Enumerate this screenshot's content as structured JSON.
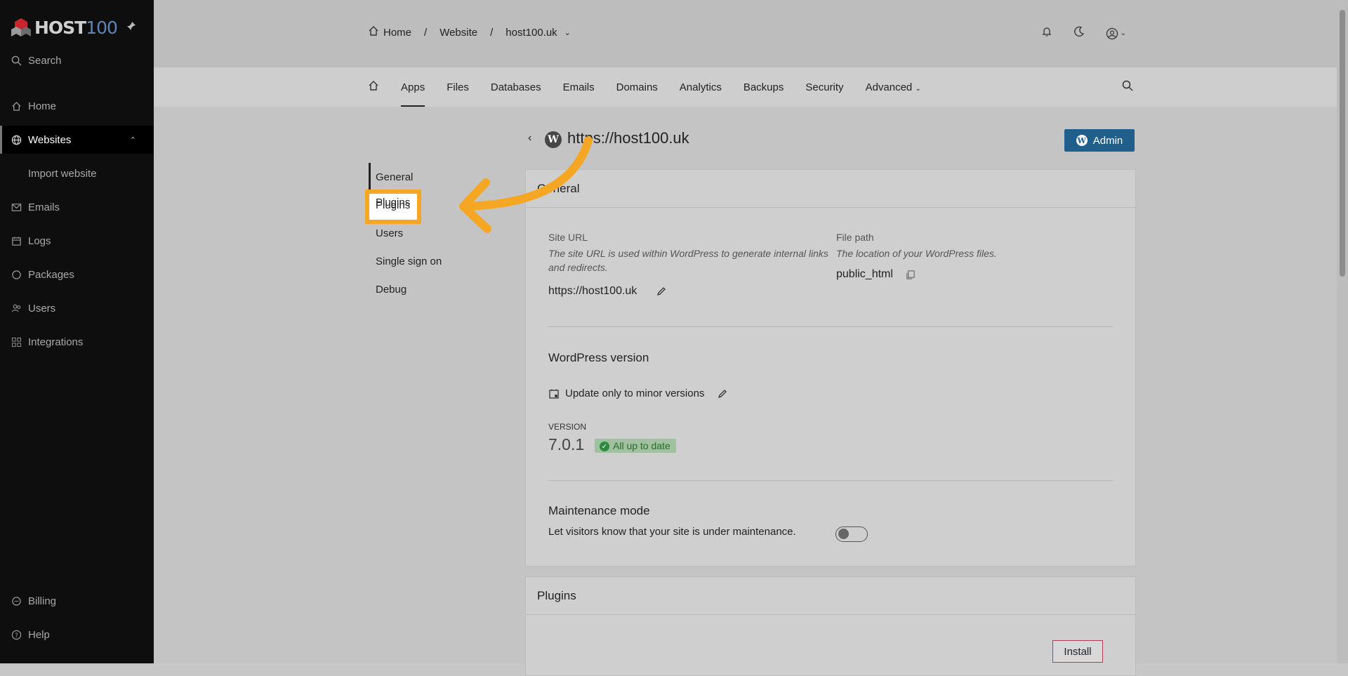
{
  "sidebar": {
    "logo": {
      "text": "HOST",
      "number": "100"
    },
    "search_label": "Search",
    "items": [
      {
        "label": "Home",
        "icon": "home-icon"
      },
      {
        "label": "Websites",
        "icon": "globe-icon"
      },
      {
        "label": "Import website"
      },
      {
        "label": "Emails",
        "icon": "mail-icon"
      },
      {
        "label": "Logs",
        "icon": "calendar-icon"
      },
      {
        "label": "Packages",
        "icon": "circle-icon"
      },
      {
        "label": "Users",
        "icon": "users-icon"
      },
      {
        "label": "Integrations",
        "icon": "grid-icon"
      }
    ],
    "bottom": [
      {
        "label": "Billing",
        "icon": "billing-icon"
      },
      {
        "label": "Help",
        "icon": "help-icon"
      }
    ]
  },
  "breadcrumb": {
    "home": "Home",
    "website": "Website",
    "domain": "host100.uk"
  },
  "tabs": [
    "Apps",
    "Files",
    "Databases",
    "Emails",
    "Domains",
    "Analytics",
    "Backups",
    "Security",
    "Advanced"
  ],
  "subnav": [
    "General",
    "Plugins",
    "Users",
    "Single sign on",
    "Debug"
  ],
  "site": {
    "title": "https://host100.uk",
    "admin_label": "Admin"
  },
  "general": {
    "heading": "General",
    "site_url_label": "Site URL",
    "site_url_desc": "The site URL is used within WordPress to generate internal links and redirects.",
    "site_url_value": "https://host100.uk",
    "file_path_label": "File path",
    "file_path_desc": "The location of your WordPress files.",
    "file_path_value": "public_html",
    "wp_version_heading": "WordPress version",
    "update_policy": "Update only to minor versions",
    "version_label": "VERSION",
    "version_value": "7.0.1",
    "version_status": "All up to date",
    "maintenance_heading": "Maintenance mode",
    "maintenance_desc": "Let visitors know that your site is under maintenance.",
    "maintenance_enabled": false
  },
  "plugins": {
    "heading": "Plugins",
    "install_label": "Install"
  },
  "colors": {
    "annotation": "#f5a623",
    "admin_button": "#205f8c",
    "sidebar": "#0e0e0e"
  }
}
